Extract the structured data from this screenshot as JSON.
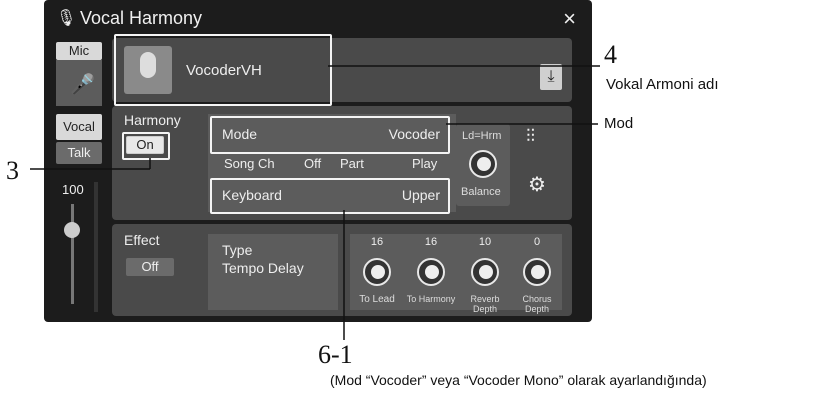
{
  "window": {
    "title": "Vocal Harmony",
    "close_glyph": "×"
  },
  "left": {
    "mic_tab": "Mic",
    "vocal_btn": "Vocal",
    "talk_btn": "Talk",
    "level": "100"
  },
  "preset": {
    "name": "VocoderVH",
    "save_icon": "save-icon"
  },
  "harmony": {
    "label": "Harmony",
    "toggle": "On",
    "mode_label": "Mode",
    "mode_value": "Vocoder",
    "song_ch_label": "Song Ch",
    "song_ch_value": "Off",
    "part_label": "Part",
    "part_value": "Play",
    "keyboard_label": "Keyboard",
    "keyboard_value": "Upper",
    "ld_hrm": "Ld=Hrm",
    "balance": "Balance"
  },
  "effect": {
    "label": "Effect",
    "toggle": "Off",
    "type_label": "Type",
    "type_value": "Tempo Delay",
    "params": [
      {
        "value": "16",
        "label": "To Lead"
      },
      {
        "value": "16",
        "label": "To Harmony"
      },
      {
        "value": "10",
        "label": "Reverb Depth"
      },
      {
        "value": "0",
        "label": "Chorus Depth"
      }
    ]
  },
  "annotations": {
    "a4_num": "4",
    "a4_text": "Vokal Armoni adı",
    "mod_text": "Mod",
    "a3_num": "3",
    "a61_num": "6-1",
    "a61_text": "(Mod “Vocoder” veya “Vocoder Mono” olarak ayarlandığında)"
  }
}
